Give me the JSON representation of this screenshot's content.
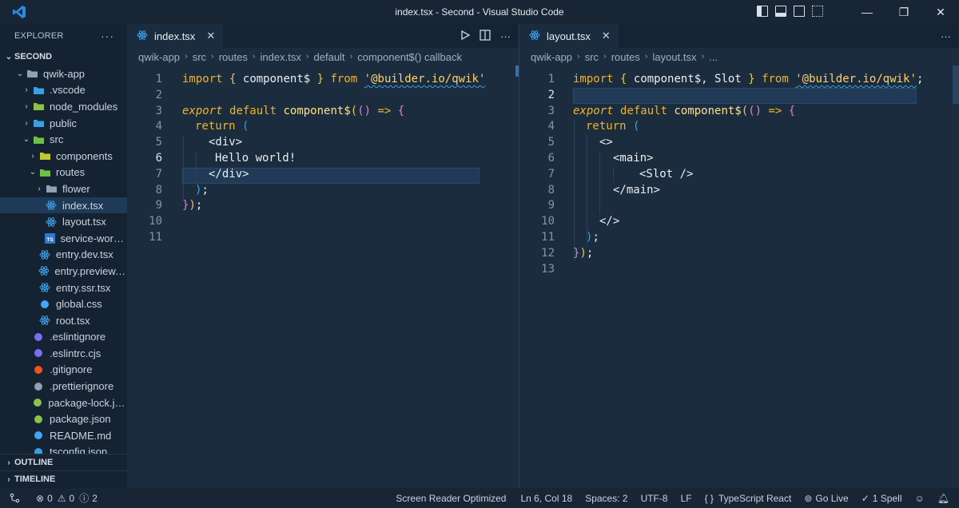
{
  "window": {
    "title": "index.tsx - Second - Visual Studio Code"
  },
  "sidebar": {
    "header": "EXPLORER",
    "more": "···",
    "root": "SECOND",
    "items": [
      {
        "label": "qwik-app",
        "depth": 1,
        "kind": "folder-open",
        "icon": "folder-icon"
      },
      {
        "label": ".vscode",
        "depth": 2,
        "kind": "folder",
        "icon": "vscode-folder-icon"
      },
      {
        "label": "node_modules",
        "depth": 2,
        "kind": "folder",
        "icon": "node-folder-icon"
      },
      {
        "label": "public",
        "depth": 2,
        "kind": "folder",
        "icon": "public-folder-icon"
      },
      {
        "label": "src",
        "depth": 2,
        "kind": "folder-open",
        "icon": "src-folder-icon"
      },
      {
        "label": "components",
        "depth": 3,
        "kind": "folder",
        "icon": "components-folder-icon"
      },
      {
        "label": "routes",
        "depth": 3,
        "kind": "folder-open",
        "icon": "routes-folder-icon"
      },
      {
        "label": "flower",
        "depth": 4,
        "kind": "folder",
        "icon": "folder-icon"
      },
      {
        "label": "index.tsx",
        "depth": 4,
        "kind": "file",
        "icon": "react-icon",
        "selected": true
      },
      {
        "label": "layout.tsx",
        "depth": 4,
        "kind": "file",
        "icon": "react-icon"
      },
      {
        "label": "service-worke...",
        "depth": 4,
        "kind": "file",
        "icon": "ts-icon"
      },
      {
        "label": "entry.dev.tsx",
        "depth": 3,
        "kind": "file",
        "icon": "react-icon"
      },
      {
        "label": "entry.preview.tsx",
        "depth": 3,
        "kind": "file",
        "icon": "react-icon"
      },
      {
        "label": "entry.ssr.tsx",
        "depth": 3,
        "kind": "file",
        "icon": "react-icon"
      },
      {
        "label": "global.css",
        "depth": 3,
        "kind": "file",
        "icon": "css-icon"
      },
      {
        "label": "root.tsx",
        "depth": 3,
        "kind": "file",
        "icon": "react-icon"
      },
      {
        "label": ".eslintignore",
        "depth": 2,
        "kind": "file",
        "icon": "eslint-icon"
      },
      {
        "label": ".eslintrc.cjs",
        "depth": 2,
        "kind": "file",
        "icon": "eslint-icon"
      },
      {
        "label": ".gitignore",
        "depth": 2,
        "kind": "file",
        "icon": "git-icon"
      },
      {
        "label": ".prettierignore",
        "depth": 2,
        "kind": "file",
        "icon": "prettier-icon"
      },
      {
        "label": "package-lock.json",
        "depth": 2,
        "kind": "file",
        "icon": "node-icon"
      },
      {
        "label": "package.json",
        "depth": 2,
        "kind": "file",
        "icon": "node-icon"
      },
      {
        "label": "README.md",
        "depth": 2,
        "kind": "file",
        "icon": "info-icon"
      },
      {
        "label": "tsconfig.json",
        "depth": 2,
        "kind": "file",
        "icon": "ts-config-icon"
      }
    ],
    "outline": "OUTLINE",
    "timeline": "TIMELINE"
  },
  "left_editor": {
    "tab": "index.tsx",
    "breadcrumb": [
      "qwik-app",
      "src",
      "routes",
      "index.tsx",
      "default",
      "component$() callback"
    ],
    "line_numbers": [
      "1",
      "2",
      "3",
      "4",
      "5",
      "6",
      "7",
      "8",
      "9",
      "10",
      "11"
    ],
    "current_line": 6
  },
  "right_editor": {
    "tab": "layout.tsx",
    "breadcrumb": [
      "qwik-app",
      "src",
      "routes",
      "layout.tsx",
      "..."
    ],
    "line_numbers": [
      "1",
      "2",
      "3",
      "4",
      "5",
      "6",
      "7",
      "8",
      "9",
      "10",
      "11",
      "12",
      "13"
    ],
    "current_line": 2
  },
  "statusbar": {
    "problems": "0",
    "warnings": "0",
    "info": "2",
    "screen_reader": "Screen Reader Optimized",
    "position": "Ln 6, Col 18",
    "spaces": "Spaces: 2",
    "encoding": "UTF-8",
    "eol": "LF",
    "language": "TypeScript React",
    "golive": "Go Live",
    "spell": "1 Spell"
  }
}
